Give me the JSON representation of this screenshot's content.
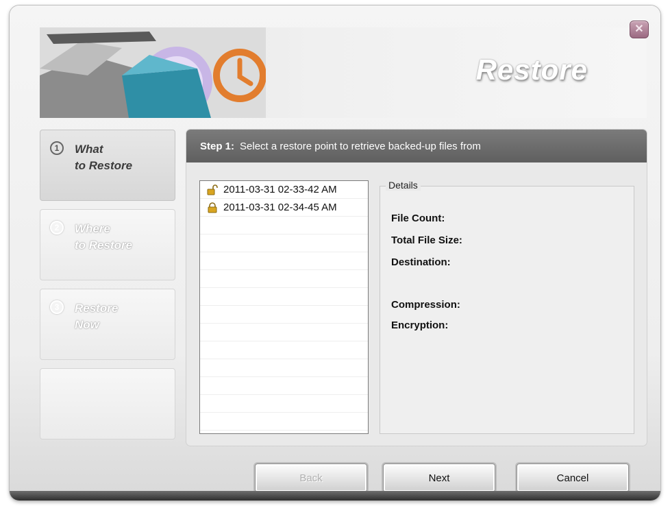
{
  "window": {
    "title": "Restore",
    "close_icon": "close-icon"
  },
  "steps": [
    {
      "number": "1",
      "line1": "What",
      "line2": "to Restore",
      "state": "active"
    },
    {
      "number": "2",
      "line1": "Where",
      "line2": "to Restore",
      "state": "inactive"
    },
    {
      "number": "3",
      "line1": "Restore",
      "line2": "Now",
      "state": "inactive"
    }
  ],
  "panel": {
    "step_tag": "Step 1:",
    "instruction": "Select a restore point to retrieve backed-up files from"
  },
  "restore_points": [
    {
      "label": "2011-03-31 02-33-42 AM",
      "icon": "unlocked-padlock-icon"
    },
    {
      "label": "2011-03-31 02-34-45 AM",
      "icon": "locked-padlock-icon"
    }
  ],
  "details": {
    "legend": "Details",
    "file_count_label": "File Count:",
    "total_size_label": "Total File Size:",
    "destination_label": "Destination:",
    "compression_label": "Compression:",
    "encryption_label": "Encryption:"
  },
  "buttons": {
    "back": "Back",
    "next": "Next",
    "cancel": "Cancel"
  },
  "colors": {
    "header_bar": "#6b6b6b",
    "lock_gold": "#d9a521"
  }
}
